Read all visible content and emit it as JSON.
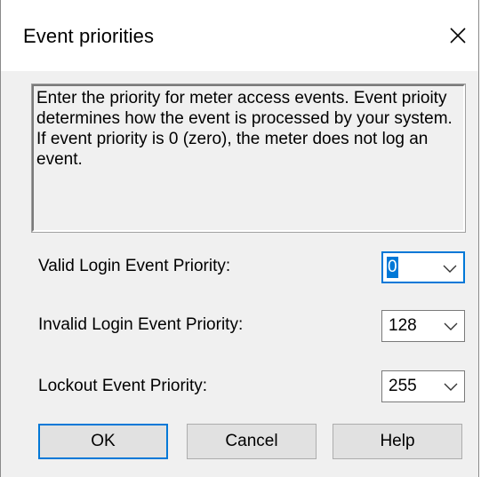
{
  "window": {
    "title": "Event priorities"
  },
  "info": {
    "text": "Enter the priority for meter access events.  Event prioity determines how the event is processed by your system.  If event priority is 0 (zero), the meter does not log an event."
  },
  "fields": [
    {
      "label": "Valid Login Event Priority:",
      "value": "0"
    },
    {
      "label": "Invalid Login Event Priority:",
      "value": "128"
    },
    {
      "label": "Lockout Event Priority:",
      "value": "255"
    }
  ],
  "buttons": {
    "ok": "OK",
    "cancel": "Cancel",
    "help": "Help"
  },
  "colors": {
    "accent": "#0078d7",
    "dialog_bg": "#f0f0f0",
    "button_bg": "#e1e1e1"
  },
  "icons": {
    "close": "close-icon",
    "dropdown": "chevron-down-icon"
  }
}
